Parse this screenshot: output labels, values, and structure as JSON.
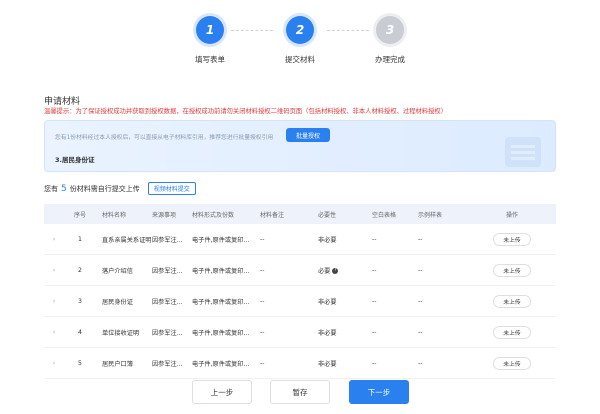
{
  "steps": [
    {
      "number": "1",
      "label": "填写表单",
      "state": "active"
    },
    {
      "number": "2",
      "label": "提交材料",
      "state": "active"
    },
    {
      "number": "3",
      "label": "办理完成",
      "state": "inactive"
    }
  ],
  "section": {
    "title": "申请材料",
    "warning": "温馨提示：为了保证授权成功并获取到授权数据，在授权成功前请勿关闭材料授权二维码页面（包括材料授权、非本人材料授权、过程材料授权）"
  },
  "card": {
    "hint": "您有1份材料经过本人授权后，可以直接从电子材料库引用，推荐您进行批量授权引用",
    "batch_button": "批量授权",
    "doc_name": "3.居民身份证"
  },
  "count": {
    "prefix": "您有",
    "number": "5",
    "suffix": "份材料需自行提交上传",
    "view_button": "视频材料提交"
  },
  "table": {
    "headers": [
      "",
      "序号",
      "材料名称",
      "来源事项",
      "材料形式及份数",
      "材料备注",
      "必要性",
      "空白表格",
      "示例样表",
      "操作"
    ],
    "rows": [
      {
        "expand": "›",
        "index": "1",
        "name": "直系亲属关系证明",
        "source": "因参军注...",
        "form": "电子件,原件或复印...",
        "note": "--",
        "necessity": "非必要",
        "blank": "--",
        "sample": "--",
        "action": "未上传"
      },
      {
        "expand": "›",
        "index": "2",
        "name": "落户介绍信",
        "source": "因参军注...",
        "form": "电子件,原件或复印...",
        "note": "--",
        "necessity": "必要",
        "blank": "--",
        "sample": "--",
        "action": "未上传"
      },
      {
        "expand": "›",
        "index": "3",
        "name": "居民身份证",
        "source": "因参军注...",
        "form": "电子件,原件或复印...",
        "note": "--",
        "necessity": "非必要",
        "blank": "--",
        "sample": "--",
        "action": "未上传"
      },
      {
        "expand": "›",
        "index": "4",
        "name": "单位接收证明",
        "source": "因参军注...",
        "form": "电子件,原件或复印...",
        "note": "--",
        "necessity": "非必要",
        "blank": "--",
        "sample": "--",
        "action": "未上传"
      },
      {
        "expand": "›",
        "index": "5",
        "name": "居民户口簿",
        "source": "因参军注...",
        "form": "电子件,原件或复印...",
        "note": "--",
        "necessity": "非必要",
        "blank": "--",
        "sample": "--",
        "action": "未上传"
      }
    ]
  },
  "footer": {
    "prev": "上一步",
    "save": "暂存",
    "next": "下一步"
  },
  "colors": {
    "primary": "#2b80f0",
    "warning": "#e03a3a",
    "inactive_step": "#c9ccd3"
  }
}
